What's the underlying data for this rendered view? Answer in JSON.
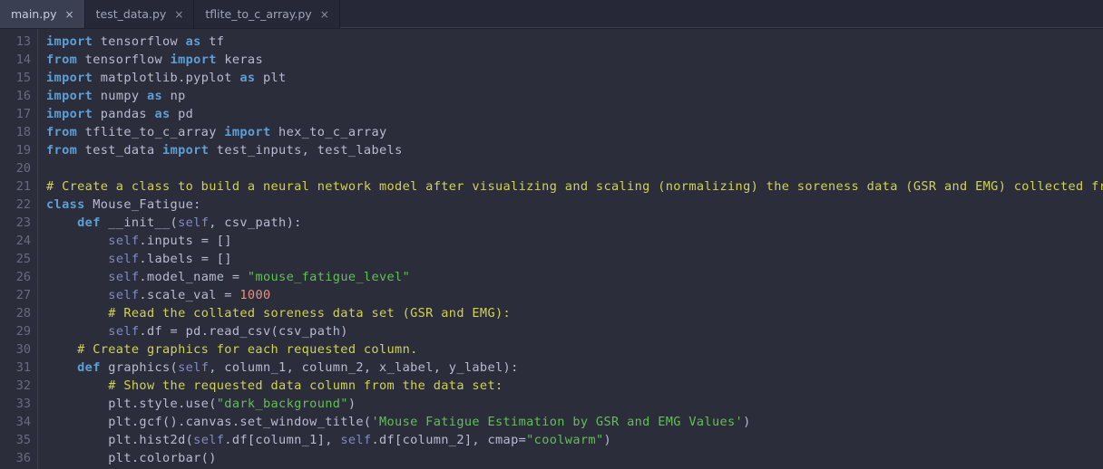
{
  "window": {
    "app": "code-editor",
    "colors": {
      "background": "#2b2d3a",
      "tabbar_background": "#262837",
      "active_tab_background": "#3b3f52",
      "keyword": "#5c9fd6",
      "self": "#8189c9",
      "comment": "#d2d255",
      "string": "#61c054",
      "number": "#e8927c",
      "default_text": "#b7bcd0",
      "line_number": "#666b80"
    }
  },
  "tabs": [
    {
      "label": "main.py",
      "close": "×",
      "active": true
    },
    {
      "label": "test_data.py",
      "close": "×",
      "active": false
    },
    {
      "label": "tflite_to_c_array.py",
      "close": "×",
      "active": false
    }
  ],
  "editor": {
    "first_line_number": 13,
    "language": "python",
    "line_numbers": [
      13,
      14,
      15,
      16,
      17,
      18,
      19,
      20,
      21,
      22,
      23,
      24,
      25,
      26,
      27,
      28,
      29,
      30,
      31,
      32,
      33,
      34,
      35,
      36
    ],
    "lines": [
      {
        "n": 13,
        "tokens": [
          {
            "t": "kw",
            "s": "import"
          },
          {
            "t": "txt",
            "s": " tensorflow "
          },
          {
            "t": "kw",
            "s": "as"
          },
          {
            "t": "txt",
            "s": " tf"
          }
        ]
      },
      {
        "n": 14,
        "tokens": [
          {
            "t": "kw",
            "s": "from"
          },
          {
            "t": "txt",
            "s": " tensorflow "
          },
          {
            "t": "kw",
            "s": "import"
          },
          {
            "t": "txt",
            "s": " keras"
          }
        ]
      },
      {
        "n": 15,
        "tokens": [
          {
            "t": "kw",
            "s": "import"
          },
          {
            "t": "txt",
            "s": " matplotlib.pyplot "
          },
          {
            "t": "kw",
            "s": "as"
          },
          {
            "t": "txt",
            "s": " plt"
          }
        ]
      },
      {
        "n": 16,
        "tokens": [
          {
            "t": "kw",
            "s": "import"
          },
          {
            "t": "txt",
            "s": " numpy "
          },
          {
            "t": "kw",
            "s": "as"
          },
          {
            "t": "txt",
            "s": " np"
          }
        ]
      },
      {
        "n": 17,
        "tokens": [
          {
            "t": "kw",
            "s": "import"
          },
          {
            "t": "txt",
            "s": " pandas "
          },
          {
            "t": "kw",
            "s": "as"
          },
          {
            "t": "txt",
            "s": " pd"
          }
        ]
      },
      {
        "n": 18,
        "tokens": [
          {
            "t": "kw",
            "s": "from"
          },
          {
            "t": "txt",
            "s": " tflite_to_c_array "
          },
          {
            "t": "kw",
            "s": "import"
          },
          {
            "t": "txt",
            "s": " hex_to_c_array"
          }
        ]
      },
      {
        "n": 19,
        "tokens": [
          {
            "t": "kw",
            "s": "from"
          },
          {
            "t": "txt",
            "s": " test_data "
          },
          {
            "t": "kw",
            "s": "import"
          },
          {
            "t": "txt",
            "s": " test_inputs, test_labels"
          }
        ]
      },
      {
        "n": 20,
        "tokens": []
      },
      {
        "n": 21,
        "tokens": [
          {
            "t": "cmt",
            "s": "# Create a class to build a neural network model after visualizing and scaling (normalizing) the soreness data (GSR and EMG) collected from the sensors."
          }
        ]
      },
      {
        "n": 22,
        "tokens": [
          {
            "t": "kw",
            "s": "class"
          },
          {
            "t": "txt",
            "s": " Mouse_Fatigue:"
          }
        ]
      },
      {
        "n": 23,
        "tokens": [
          {
            "t": "txt",
            "s": "    "
          },
          {
            "t": "kw",
            "s": "def"
          },
          {
            "t": "txt",
            "s": " __init__("
          },
          {
            "t": "self",
            "s": "self"
          },
          {
            "t": "txt",
            "s": ", csv_path):"
          }
        ]
      },
      {
        "n": 24,
        "tokens": [
          {
            "t": "txt",
            "s": "        "
          },
          {
            "t": "self",
            "s": "self"
          },
          {
            "t": "txt",
            "s": ".inputs = []"
          }
        ]
      },
      {
        "n": 25,
        "tokens": [
          {
            "t": "txt",
            "s": "        "
          },
          {
            "t": "self",
            "s": "self"
          },
          {
            "t": "txt",
            "s": ".labels = []"
          }
        ]
      },
      {
        "n": 26,
        "tokens": [
          {
            "t": "txt",
            "s": "        "
          },
          {
            "t": "self",
            "s": "self"
          },
          {
            "t": "txt",
            "s": ".model_name = "
          },
          {
            "t": "str",
            "s": "\"mouse_fatigue_level\""
          }
        ]
      },
      {
        "n": 27,
        "tokens": [
          {
            "t": "txt",
            "s": "        "
          },
          {
            "t": "self",
            "s": "self"
          },
          {
            "t": "txt",
            "s": ".scale_val = "
          },
          {
            "t": "num",
            "s": "1000"
          }
        ]
      },
      {
        "n": 28,
        "tokens": [
          {
            "t": "txt",
            "s": "        "
          },
          {
            "t": "cmt",
            "s": "# Read the collated soreness data set (GSR and EMG):"
          }
        ]
      },
      {
        "n": 29,
        "tokens": [
          {
            "t": "txt",
            "s": "        "
          },
          {
            "t": "self",
            "s": "self"
          },
          {
            "t": "txt",
            "s": ".df = pd.read_csv(csv_path)"
          }
        ]
      },
      {
        "n": 30,
        "tokens": [
          {
            "t": "txt",
            "s": "    "
          },
          {
            "t": "cmt",
            "s": "# Create graphics for each requested column."
          }
        ]
      },
      {
        "n": 31,
        "tokens": [
          {
            "t": "txt",
            "s": "    "
          },
          {
            "t": "kw",
            "s": "def"
          },
          {
            "t": "txt",
            "s": " graphics("
          },
          {
            "t": "self",
            "s": "self"
          },
          {
            "t": "txt",
            "s": ", column_1, column_2, x_label, y_label):"
          }
        ]
      },
      {
        "n": 32,
        "tokens": [
          {
            "t": "txt",
            "s": "        "
          },
          {
            "t": "cmt",
            "s": "# Show the requested data column from the data set:"
          }
        ]
      },
      {
        "n": 33,
        "tokens": [
          {
            "t": "txt",
            "s": "        plt.style.use("
          },
          {
            "t": "str",
            "s": "\"dark_background\""
          },
          {
            "t": "txt",
            "s": ")"
          }
        ]
      },
      {
        "n": 34,
        "tokens": [
          {
            "t": "txt",
            "s": "        plt.gcf().canvas.set_window_title("
          },
          {
            "t": "str",
            "s": "'Mouse Fatigue Estimation by GSR and EMG Values'"
          },
          {
            "t": "txt",
            "s": ")"
          }
        ]
      },
      {
        "n": 35,
        "tokens": [
          {
            "t": "txt",
            "s": "        plt.hist2d("
          },
          {
            "t": "self",
            "s": "self"
          },
          {
            "t": "txt",
            "s": ".df[column_1], "
          },
          {
            "t": "self",
            "s": "self"
          },
          {
            "t": "txt",
            "s": ".df[column_2], cmap="
          },
          {
            "t": "str",
            "s": "\"coolwarm\""
          },
          {
            "t": "txt",
            "s": ")"
          }
        ]
      },
      {
        "n": 36,
        "tokens": [
          {
            "t": "txt",
            "s": "        plt.colorbar()"
          }
        ]
      }
    ]
  }
}
